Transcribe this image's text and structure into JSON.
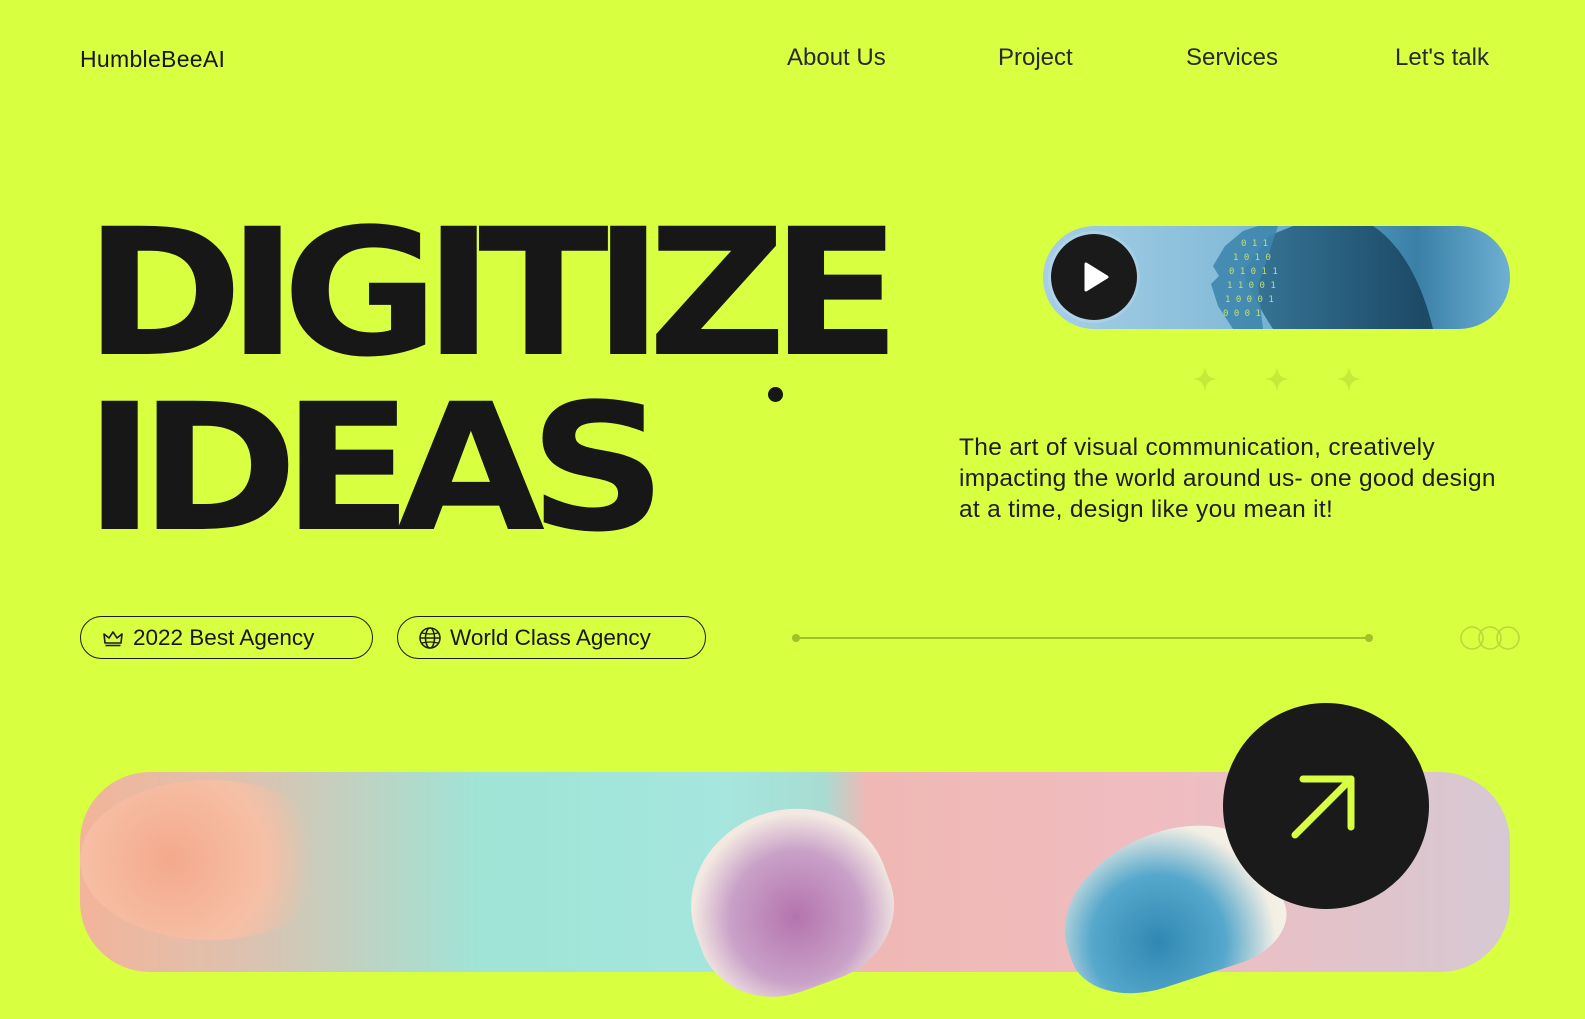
{
  "brand": {
    "name": "HumbleBeeAI"
  },
  "nav": {
    "items": [
      {
        "label": "About Us"
      },
      {
        "label": "Project"
      },
      {
        "label": "Services"
      },
      {
        "label": "Let's talk"
      }
    ]
  },
  "hero": {
    "headline_line1": "DIGITIZE",
    "headline_line2": "IDEAS",
    "tagline": "The art of visual communication, creatively impacting the world around us- one good design at a time, design like you mean it!",
    "badges": [
      {
        "label": "2022 Best Agency",
        "icon": "crown-icon"
      },
      {
        "label": "World Class Agency",
        "icon": "globe-icon"
      }
    ]
  },
  "colors": {
    "background": "#d9ff41",
    "text": "#171717",
    "accent_dark": "#1a1a1a",
    "accent_lime": "#d9ff41"
  },
  "icons": {
    "play": "play-icon",
    "sparkle": "sparkle-icon",
    "arrow": "arrow-up-right-icon",
    "rings": "rings-icon"
  }
}
